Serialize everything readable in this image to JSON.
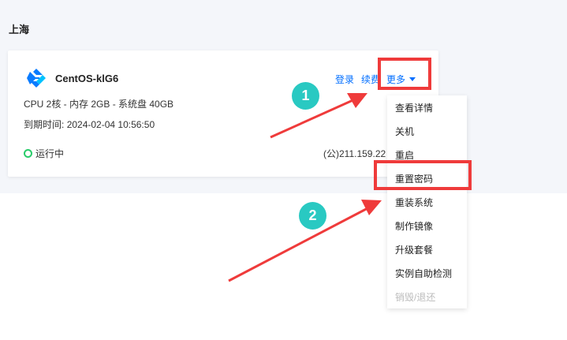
{
  "region": {
    "title": "上海"
  },
  "instance": {
    "name": "CentOS-klG6",
    "spec": "CPU 2核 - 内存 2GB - 系统盘 40GB",
    "expire_label": "到期时间:",
    "expire_value": "2024-02-04 10:56:50",
    "status": "运行中",
    "ip": "(公)211.159.22",
    "logo_icon": "centos-logo-icon",
    "status_color": "#29cc6a"
  },
  "actions": {
    "login": "登录",
    "renew": "续费",
    "more": "更多"
  },
  "menu": {
    "items": [
      {
        "label": "查看详情"
      },
      {
        "label": "关机"
      },
      {
        "label": "重启"
      },
      {
        "label": "重置密码"
      },
      {
        "label": "重装系统"
      },
      {
        "label": "制作镜像"
      },
      {
        "label": "升级套餐"
      },
      {
        "label": "实例自助检测"
      },
      {
        "label": "销毁/退还"
      }
    ]
  },
  "annotations": {
    "step1": "1",
    "step2": "2",
    "highlight_color": "#ef3b3b",
    "badge_color": "#29c9c2"
  },
  "colors": {
    "link": "#006eff",
    "background": "#f4f6fa"
  }
}
